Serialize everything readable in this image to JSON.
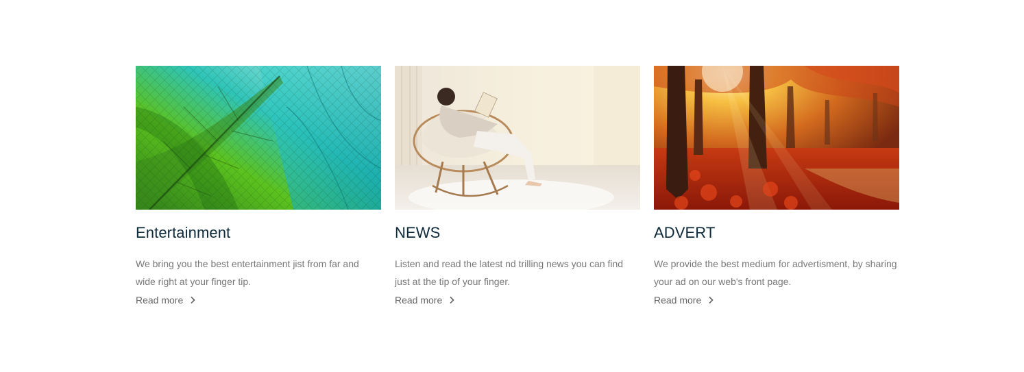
{
  "cards": [
    {
      "image": "leaf-veins-image",
      "title": "Entertainment",
      "text": "We bring you the best entertainment jist from far and wide right at your finger tip.",
      "link": "Read more",
      "link_icon": "chevron-right-icon"
    },
    {
      "image": "woman-reading-chair-image",
      "title": "NEWS",
      "text": "Listen and read the latest nd trilling news you can find just at the tip of your finger.",
      "link": "Read more",
      "link_icon": "chevron-right-icon"
    },
    {
      "image": "autumn-forest-image",
      "title": "ADVERT",
      "text": "We provide the best medium for advertisment, by sharing your ad on our web's front page.",
      "link": "Read more",
      "link_icon": "chevron-right-icon"
    }
  ],
  "colors": {
    "title": "#0d2a3a",
    "body_text": "#777777",
    "link": "#666666"
  }
}
